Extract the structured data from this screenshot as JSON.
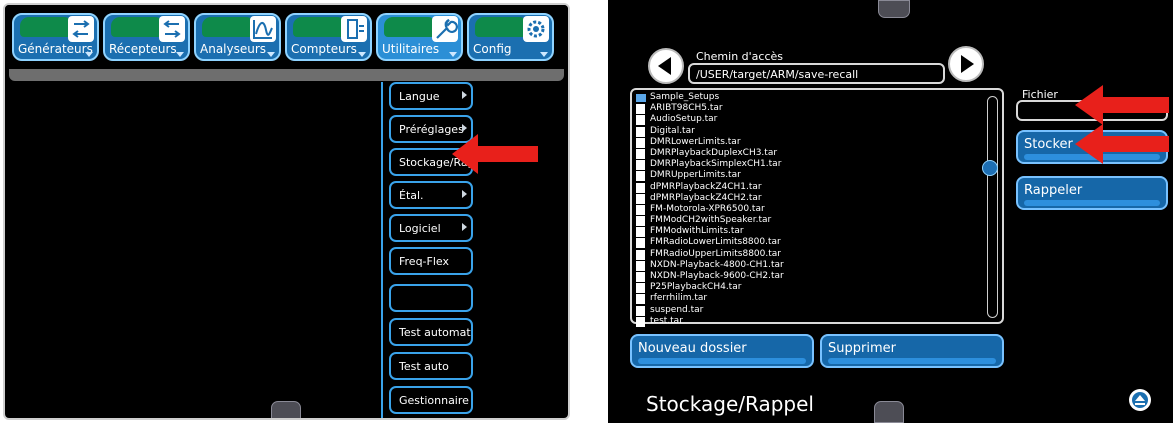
{
  "left": {
    "toolbar": [
      {
        "label": "Générateurs",
        "icon": "generators-icon",
        "active": false
      },
      {
        "label": "Récepteurs",
        "icon": "receivers-icon",
        "active": false
      },
      {
        "label": "Analyseurs",
        "icon": "analyzers-icon",
        "active": false
      },
      {
        "label": "Compteurs",
        "icon": "counters-icon",
        "active": false
      },
      {
        "label": "Utilitaires",
        "icon": "wrench-icon",
        "active": true
      },
      {
        "label": "Config",
        "icon": "gear-icon",
        "active": false
      }
    ],
    "menu": [
      {
        "label": "Langue",
        "submenu": true
      },
      {
        "label": "Préréglages",
        "submenu": true
      },
      {
        "label": "Stockage/Rappel",
        "submenu": false
      },
      {
        "label": "Étal.",
        "submenu": true
      },
      {
        "label": "Logiciel",
        "submenu": true
      },
      {
        "label": "Freq-Flex",
        "submenu": false
      },
      {
        "label": "",
        "submenu": false
      },
      {
        "label": "Test automatique",
        "submenu": false
      },
      {
        "label": "Test auto",
        "submenu": false
      },
      {
        "label": "Gestionnaire d",
        "submenu": false
      }
    ]
  },
  "right": {
    "path_label": "Chemin d'accès",
    "path_value": "/USER/target/ARM/save-recall",
    "files": [
      {
        "name": "Sample_Setups",
        "type": "folder"
      },
      {
        "name": "ARIBT98CH5.tar",
        "type": "file"
      },
      {
        "name": "AudioSetup.tar",
        "type": "file"
      },
      {
        "name": "Digital.tar",
        "type": "file"
      },
      {
        "name": "DMRLowerLimits.tar",
        "type": "file"
      },
      {
        "name": "DMRPlaybackDuplexCH3.tar",
        "type": "file"
      },
      {
        "name": "DMRPlaybackSimplexCH1.tar",
        "type": "file"
      },
      {
        "name": "DMRUpperLimits.tar",
        "type": "file"
      },
      {
        "name": "dPMRPlaybackZ4CH1.tar",
        "type": "file"
      },
      {
        "name": "dPMRPlaybackZ4CH2.tar",
        "type": "file"
      },
      {
        "name": "FM-Motorola-XPR6500.tar",
        "type": "file"
      },
      {
        "name": "FMModCH2withSpeaker.tar",
        "type": "file"
      },
      {
        "name": "FMModwithLimits.tar",
        "type": "file"
      },
      {
        "name": "FMRadioLowerLimits8800.tar",
        "type": "file"
      },
      {
        "name": "FMRadioUpperLimits8800.tar",
        "type": "file"
      },
      {
        "name": "NXDN-Playback-4800-CH1.tar",
        "type": "file"
      },
      {
        "name": "NXDN-Playback-9600-CH2.tar",
        "type": "file"
      },
      {
        "name": "P25PlaybackCH4.tar",
        "type": "file"
      },
      {
        "name": "rferrhilim.tar",
        "type": "file"
      },
      {
        "name": "suspend.tar",
        "type": "file"
      },
      {
        "name": "test.tar",
        "type": "file"
      }
    ],
    "file_label": "Fichier",
    "file_value": "",
    "store_label": "Stocker",
    "recall_label": "Rappeler",
    "new_folder_label": "Nouveau dossier",
    "delete_label": "Supprimer",
    "title": "Stockage/Rappel"
  },
  "colors": {
    "accent": "#1b6fb0",
    "accent_border": "#8fd3ff",
    "highlight_arrow": "#e8201b",
    "indicator_green": "#0e8a4a"
  }
}
